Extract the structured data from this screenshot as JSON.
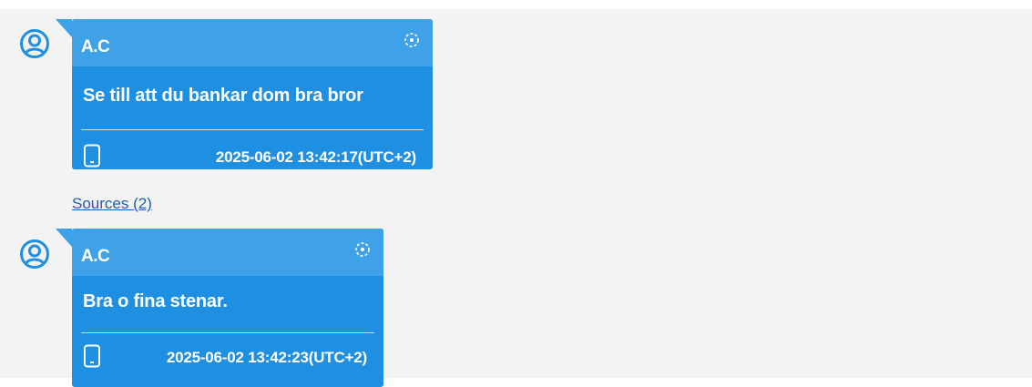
{
  "colors": {
    "bubble": "#1e8fe1",
    "bubble_header": "#3fa1e7",
    "avatar": "#1e8fe1",
    "link": "#1a5fb4",
    "panel_background": "#f3f3f3"
  },
  "messages": [
    {
      "sender": "A.C",
      "text": "Se till att du bankar dom bra bror",
      "timestamp": "2025-06-02 13:42:17(UTC+2)",
      "avatar_icon": "user-circle-icon",
      "status_icon": "status-spinner-icon",
      "device_icon": "mobile-phone-icon",
      "sources_label": "Sources (2)"
    },
    {
      "sender": "A.C",
      "text": "Bra o fina stenar.",
      "timestamp": "2025-06-02 13:42:23(UTC+2)",
      "avatar_icon": "user-circle-icon",
      "status_icon": "status-spinner-icon",
      "device_icon": "mobile-phone-icon"
    }
  ]
}
